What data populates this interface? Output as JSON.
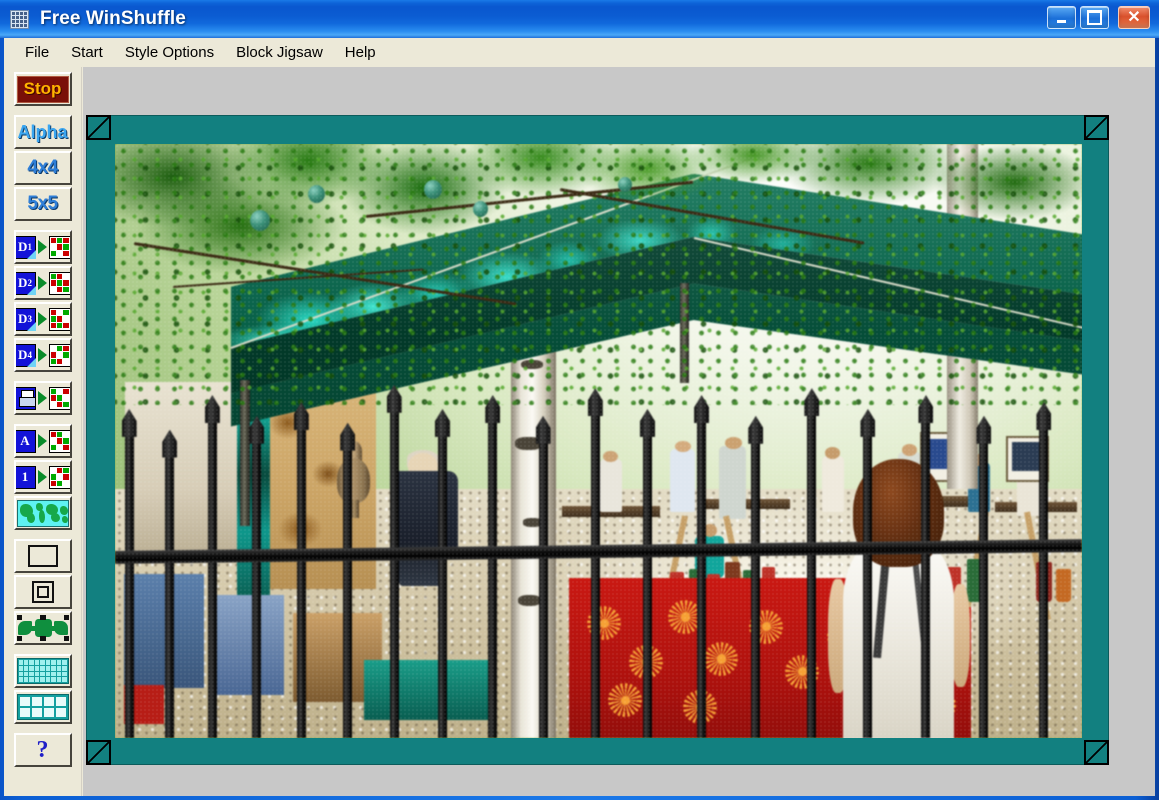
{
  "window": {
    "title": "Free WinShuffle",
    "icon": "grid-app-icon",
    "controls": {
      "minimize": "Minimize",
      "maximize": "Maximize",
      "close": "Close"
    }
  },
  "menu": {
    "items": [
      {
        "label": "File"
      },
      {
        "label": "Start"
      },
      {
        "label": "Style Options"
      },
      {
        "label": "Block Jigsaw"
      },
      {
        "label": "Help"
      }
    ]
  },
  "toolbar": {
    "buttons": [
      {
        "name": "stop-button",
        "label": "Stop",
        "icon": "stop-label",
        "type": "text"
      },
      {
        "name": "alpha-button",
        "label": "Alpha",
        "icon": "alpha-label",
        "type": "text"
      },
      {
        "name": "grid-4x4-button",
        "label": "4x4",
        "icon": "grid-4x4-label",
        "type": "text"
      },
      {
        "name": "grid-5x5-button",
        "label": "5x5",
        "icon": "grid-5x5-label",
        "type": "text"
      },
      {
        "name": "difficulty-1-button",
        "label": "D1",
        "icon": "difficulty-1-icon",
        "type": "icon"
      },
      {
        "name": "difficulty-2-button",
        "label": "D2",
        "icon": "difficulty-2-icon",
        "type": "icon"
      },
      {
        "name": "difficulty-3-button",
        "label": "D3",
        "icon": "difficulty-3-icon",
        "type": "icon"
      },
      {
        "name": "difficulty-4-button",
        "label": "D4",
        "icon": "difficulty-4-icon",
        "type": "icon"
      },
      {
        "name": "save-button",
        "label": "",
        "icon": "floppy-disk-icon",
        "type": "icon"
      },
      {
        "name": "alpha-shuffle-button",
        "label": "A",
        "icon": "letter-a-icon",
        "type": "icon"
      },
      {
        "name": "one-shuffle-button",
        "label": "1",
        "icon": "number-one-icon",
        "type": "icon"
      },
      {
        "name": "world-map-button",
        "label": "",
        "icon": "world-map-icon",
        "type": "icon"
      },
      {
        "name": "frame-off-button",
        "label": "",
        "icon": "rectangle-outline-icon",
        "type": "icon"
      },
      {
        "name": "frame-on-button",
        "label": "",
        "icon": "double-rectangle-icon",
        "type": "icon"
      },
      {
        "name": "jigsaw-button",
        "label": "",
        "icon": "jigsaw-piece-icon",
        "type": "icon"
      },
      {
        "name": "fine-grid-button",
        "label": "",
        "icon": "fine-grid-icon",
        "type": "icon"
      },
      {
        "name": "coarse-grid-button",
        "label": "",
        "icon": "coarse-grid-icon",
        "type": "icon"
      },
      {
        "name": "help-button",
        "label": "?",
        "icon": "question-mark-icon",
        "type": "text"
      }
    ]
  },
  "canvas": {
    "frame_color": "#128080",
    "background_color": "#c8c8c8",
    "corner_handles": 4,
    "photo": {
      "description": "Outdoor craft market scene: a dark green pop-up canopy tent with dappled sunlight, leafy tree branches overhead, a birch tree trunk, a woman with brown hair in a white tank top and backpack seen from behind, a red banner with orange sunburst motifs, pottery and candles on stands, and a black wrought-iron spear-topped fence across the foreground.",
      "dominant_colors": [
        "#0a6048",
        "#2fd6c2",
        "#c11a14",
        "#f2a23c",
        "#d7b67e",
        "#000000"
      ]
    }
  }
}
